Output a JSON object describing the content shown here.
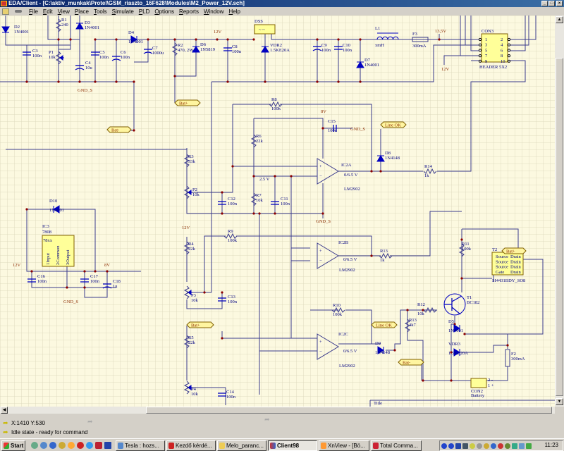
{
  "window": {
    "title": "EDA/Client - [C:\\aktiv_munkak\\Protel\\GSM_riaszto_16F628\\Modules\\M2_Power_12V.sch]",
    "menu": [
      "File",
      "Edit",
      "View",
      "Place",
      "Tools",
      "Simulate",
      "PLD",
      "Options",
      "Reports",
      "Window",
      "Help"
    ]
  },
  "schematic": {
    "parts": {
      "D2": {
        "ref": "D2",
        "value": "1N4001"
      },
      "R1": {
        "ref": "R1",
        "value": "240"
      },
      "D3": {
        "ref": "D3",
        "value": "1N4001"
      },
      "C3": {
        "ref": "C3",
        "value": "100n"
      },
      "P1": {
        "ref": "P1",
        "value": "10k"
      },
      "C4": {
        "ref": "C4",
        "value": "10u"
      },
      "C5": {
        "ref": "C5",
        "value": "100n"
      },
      "C6": {
        "ref": "C6",
        "value": "100n"
      },
      "D4": {
        "ref": "D4",
        "value": "1N4001"
      },
      "C7": {
        "ref": "C7",
        "value": "1000u"
      },
      "R2": {
        "ref": "R2",
        "value": "470, 2W"
      },
      "D6": {
        "ref": "D6",
        "value": "1N5819"
      },
      "C8": {
        "ref": "C8",
        "value": "100n"
      },
      "DSS": {
        "ref": "DSS",
        "value": ""
      },
      "VDR2": {
        "ref": "VDR2",
        "value": "1.5KE20A"
      },
      "C9": {
        "ref": "C9",
        "value": "100n"
      },
      "C10": {
        "ref": "C10",
        "value": "100n"
      },
      "D7": {
        "ref": "D7",
        "value": "1N4001"
      },
      "L1": {
        "ref": "L1",
        "value": "xmH"
      },
      "F3": {
        "ref": "F3",
        "value": "300mA"
      },
      "CON3": {
        "ref": "CON3",
        "value": "HEADER 5X2"
      },
      "R8": {
        "ref": "R8",
        "value": "100k"
      },
      "C15": {
        "ref": "C15",
        "value": "100n"
      },
      "D8": {
        "ref": "D8",
        "value": "1N4148"
      },
      "IC2A": {
        "ref": "IC2A",
        "value": "LM2902"
      },
      "R14": {
        "ref": "R14",
        "value": "1k"
      },
      "R3": {
        "ref": "R3",
        "value": "33k"
      },
      "P2": {
        "ref": "P2",
        "value": "10k"
      },
      "C12": {
        "ref": "C12",
        "value": "100n"
      },
      "R6": {
        "ref": "R6",
        "value": "22k"
      },
      "R7": {
        "ref": "R7",
        "value": "10k"
      },
      "C11": {
        "ref": "C11",
        "value": "100n"
      },
      "D10": {
        "ref": "D10",
        "value": "1N4001"
      },
      "IC3": {
        "ref": "IC3",
        "value": "7808"
      },
      "C16": {
        "ref": "C16",
        "value": "100n"
      },
      "C17": {
        "ref": "C17",
        "value": "100n"
      },
      "C18": {
        "ref": "C18",
        "value": "1u"
      },
      "R4": {
        "ref": "R4",
        "value": "22k"
      },
      "R9": {
        "ref": "R9",
        "value": "100k"
      },
      "IC2B": {
        "ref": "IC2B",
        "value": "LM2902"
      },
      "R13a": {
        "ref": "R13",
        "value": "1k"
      },
      "R11": {
        "ref": "R11",
        "value": "100k"
      },
      "T2": {
        "ref": "T2",
        "value": "SI4431BDY_SO8"
      },
      "P3": {
        "ref": "P3",
        "value": "10k"
      },
      "C13": {
        "ref": "C13",
        "value": "100n"
      },
      "R10": {
        "ref": "R10",
        "value": "100k"
      },
      "IC2C": {
        "ref": "IC2C",
        "value": "LM2902"
      },
      "R12": {
        "ref": "R12",
        "value": "10k"
      },
      "T1": {
        "ref": "T1",
        "value": "BC182"
      },
      "R13b": {
        "ref": "R13",
        "value": "4k7"
      },
      "D5": {
        "ref": "D5",
        "value": "1N4001"
      },
      "VDR3": {
        "ref": "VDR3",
        "value": "1.5KE20A"
      },
      "F2": {
        "ref": "F2",
        "value": "300mA"
      },
      "R5": {
        "ref": "R5",
        "value": "22k"
      },
      "P4": {
        "ref": "P4",
        "value": "10k"
      },
      "C14": {
        "ref": "C14",
        "value": "100n"
      },
      "D9": {
        "ref": "D9",
        "value": "1N4148"
      },
      "CON2": {
        "ref": "CON2",
        "value": "Battery"
      }
    },
    "nets": {
      "v12": "12V",
      "v13_5": "13,5V",
      "v8": "8V",
      "gnd": "GND_S",
      "bat_plus": "Bat+",
      "bat_minus": "Bat-",
      "line_ok": "Line OK",
      "v2_5": "2.5 V",
      "out": "0/6.5 V"
    },
    "ic3_pins": [
      "1Input",
      "2Common",
      "3Output"
    ],
    "ic3_note": "78xx",
    "t2_pins": [
      [
        "Source",
        "Drain"
      ],
      [
        "Source",
        "Drain"
      ],
      [
        "Source",
        "Drain"
      ],
      [
        "Gate",
        "Drain"
      ]
    ],
    "con3_pins": [
      "1",
      "2",
      "3",
      "4",
      "5",
      "6",
      "7",
      "8",
      "9",
      "10"
    ],
    "con2_pins": [
      "2 -",
      "1 +"
    ],
    "title_block": "Title",
    "colors": {
      "wire": "#3a3a8c",
      "part": "#0000c0",
      "net": "#8b2c00",
      "part_fill": "#ffff99",
      "background": "#fcf9e0",
      "grid": "#d8d4b8"
    }
  },
  "status": {
    "coords": "X:1410 Y:530",
    "state": "Idle state - ready for command"
  },
  "taskbar": {
    "start": "Start",
    "tasks": [
      "Tesla : hozs...",
      "Kezdő kérdé...",
      "Melo_paranc...",
      "Client98",
      "XnView - [Bö...",
      "Total Comma..."
    ],
    "active_task": "Client98",
    "clock": "11:23"
  }
}
